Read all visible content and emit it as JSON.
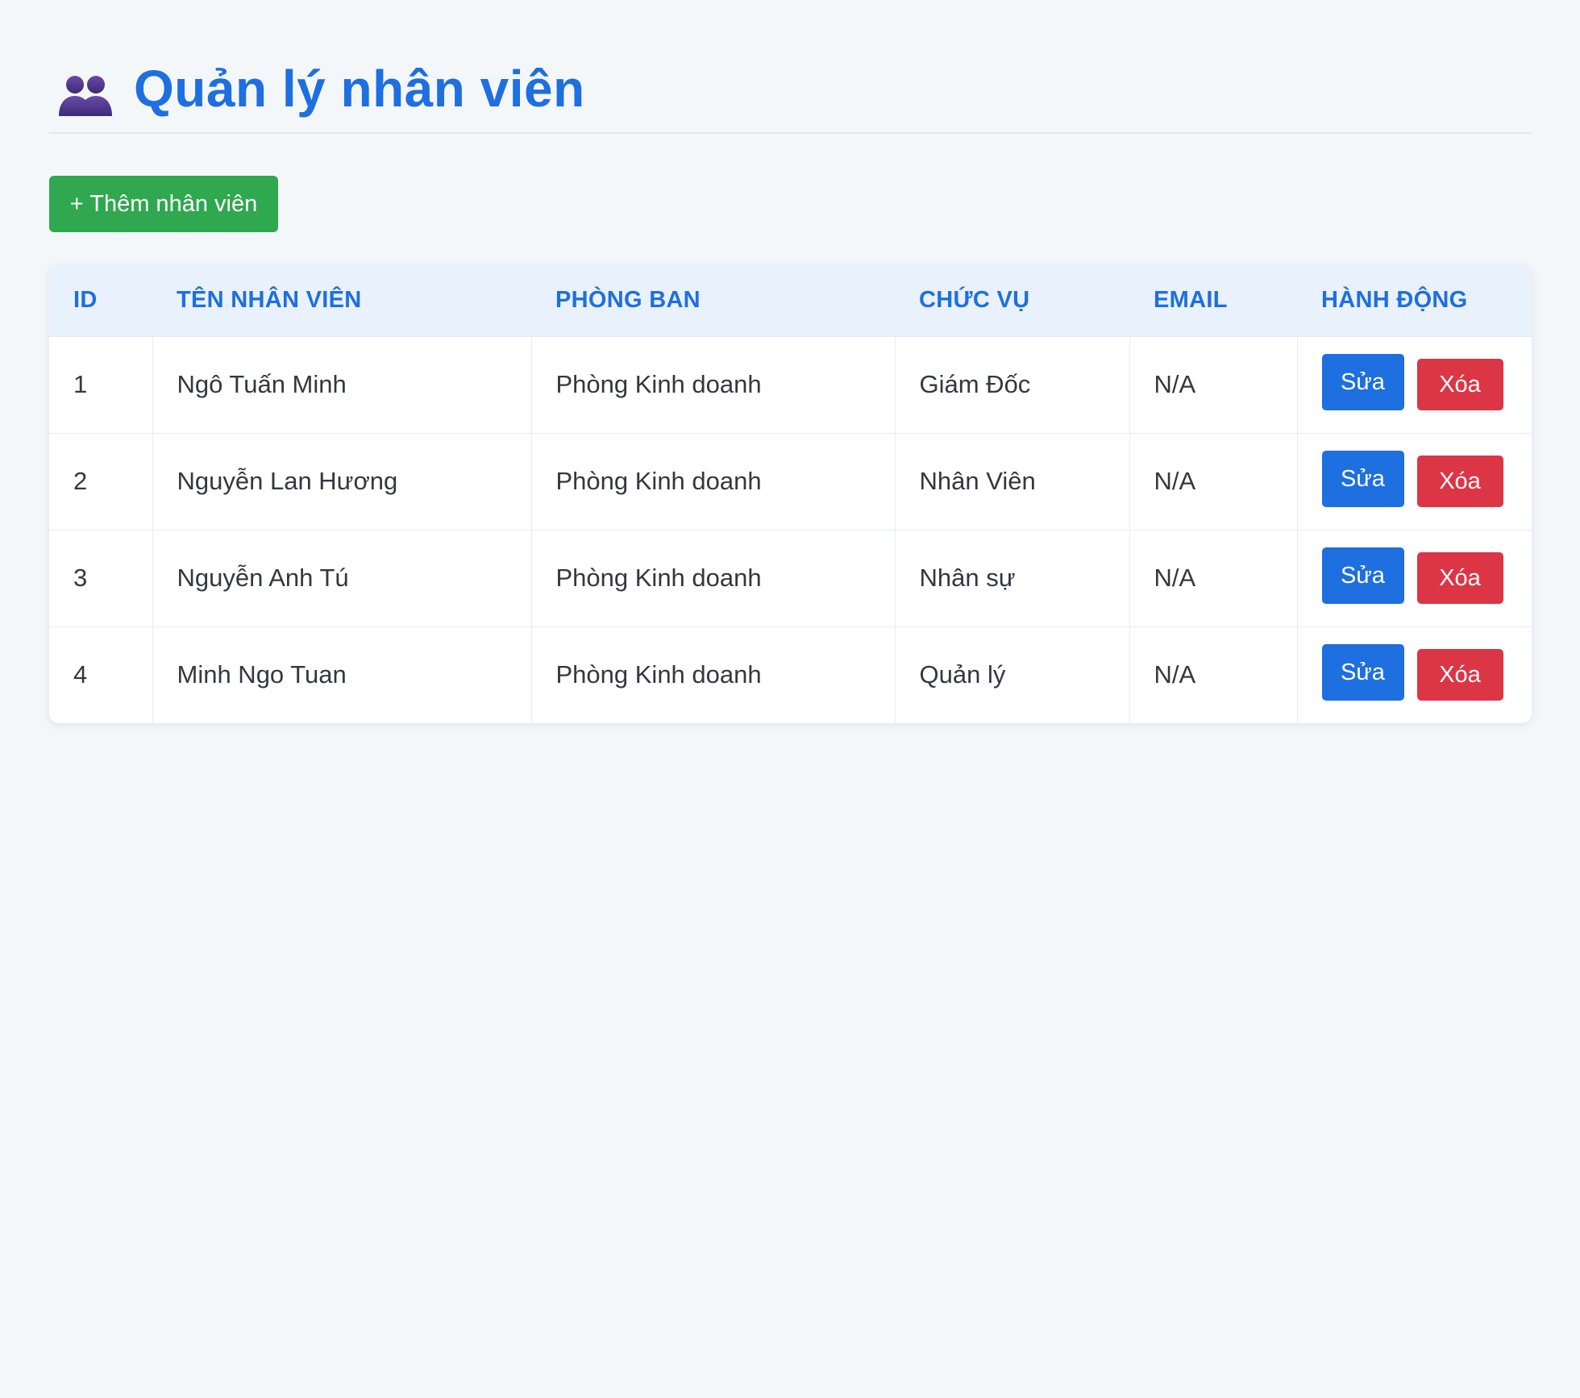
{
  "header": {
    "icon": "people-icon",
    "title": "Quản lý nhân viên"
  },
  "toolbar": {
    "add_label": "+ Thêm nhân viên",
    "add_color": "#2fa84f"
  },
  "colors": {
    "accent": "#1e6fe0",
    "danger": "#dc3545",
    "header_bg": "#e9f1fc",
    "page_bg": "#f4f7fa"
  },
  "table": {
    "headers": [
      "ID",
      "TÊN NHÂN VIÊN",
      "PHÒNG BAN",
      "CHỨC VỤ",
      "EMAIL",
      "HÀNH ĐỘNG"
    ],
    "rows": [
      {
        "id": "1",
        "name": "Ngô Tuấn Minh",
        "department": "Phòng Kinh doanh",
        "position": "Giám Đốc",
        "email": "N/A",
        "edit_label": "Sửa",
        "delete_label": "Xóa"
      },
      {
        "id": "2",
        "name": "Nguyễn Lan Hương",
        "department": "Phòng Kinh doanh",
        "position": "Nhân Viên",
        "email": "N/A",
        "edit_label": "Sửa",
        "delete_label": "Xóa"
      },
      {
        "id": "3",
        "name": "Nguyễn Anh Tú",
        "department": "Phòng Kinh doanh",
        "position": "Nhân sự",
        "email": "N/A",
        "edit_label": "Sửa",
        "delete_label": "Xóa"
      },
      {
        "id": "4",
        "name": "Minh Ngo Tuan",
        "department": "Phòng Kinh doanh",
        "position": "Quản lý",
        "email": "N/A",
        "edit_label": "Sửa",
        "delete_label": "Xóa"
      }
    ]
  }
}
